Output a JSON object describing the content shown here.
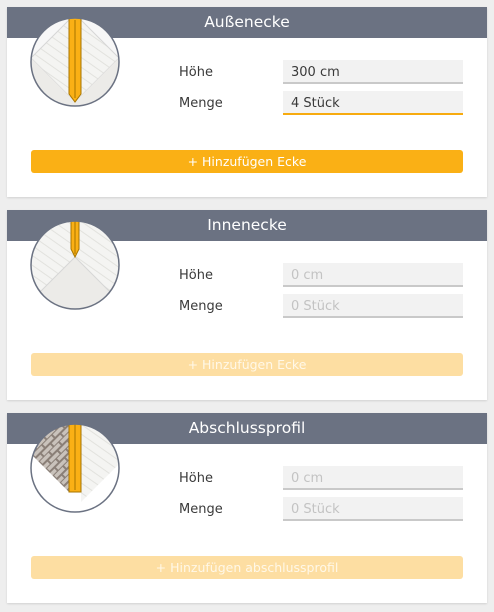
{
  "cards": [
    {
      "title": "Außenecke",
      "height_label": "Höhe",
      "height_value": "300 cm",
      "height_placeholder": "0 cm",
      "quantity_label": "Menge",
      "quantity_value": "4 Stück",
      "quantity_placeholder": "0 Stück",
      "button_label": "+ Hinzufügen Ecke",
      "button_state": "active",
      "icon": "outer-corner-icon"
    },
    {
      "title": "Innenecke",
      "height_label": "Höhe",
      "height_value": "",
      "height_placeholder": "0 cm",
      "quantity_label": "Menge",
      "quantity_value": "",
      "quantity_placeholder": "0 Stück",
      "button_label": "+ Hinzufügen Ecke",
      "button_state": "disabled",
      "icon": "inner-corner-icon"
    },
    {
      "title": "Abschlussprofil",
      "height_label": "Höhe",
      "height_value": "",
      "height_placeholder": "0 cm",
      "quantity_label": "Menge",
      "quantity_value": "",
      "quantity_placeholder": "0 Stück",
      "button_label": "+ Hinzufügen abschlussprofil",
      "button_state": "disabled",
      "icon": "end-profile-icon"
    }
  ],
  "colors": {
    "header": "#6b7282",
    "accent": "#fab015",
    "accent_disabled": "#fddea2",
    "input_bg": "#f2f2f2"
  }
}
